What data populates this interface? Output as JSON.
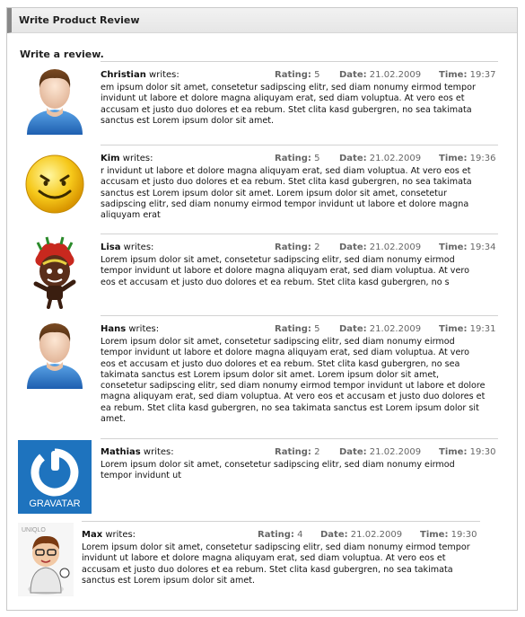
{
  "panel": {
    "title": "Write Product Review"
  },
  "intro": "Write a review.",
  "labels": {
    "writes": "writes:",
    "rating": "Rating:",
    "date": "Date:",
    "time": "Time:"
  },
  "reviews": [
    {
      "author": "Christian",
      "rating": "5",
      "date": "21.02.2009",
      "time": "19:37",
      "avatar_icon": "default-user-avatar-icon",
      "text": "em ipsum dolor sit amet, consetetur sadipscing elitr, sed diam nonumy eirmod tempor invidunt ut labore et dolore magna aliquyam erat, sed diam voluptua. At vero eos et accusam et justo duo dolores et ea rebum. Stet clita kasd gubergren, no sea takimata sanctus est Lorem ipsum dolor sit amet."
    },
    {
      "author": "Kim",
      "rating": "5",
      "date": "21.02.2009",
      "time": "19:36",
      "avatar_icon": "smiley-avatar-icon",
      "text": "r invidunt ut labore et dolore magna aliquyam erat, sed diam voluptua. At vero eos et accusam et justo duo dolores et ea rebum. Stet clita kasd gubergren, no sea takimata sanctus est Lorem ipsum dolor sit amet. Lorem ipsum dolor sit amet, consetetur sadipscing elitr, sed diam nonumy eirmod tempor invidunt ut labore et dolore magna aliquyam erat"
    },
    {
      "author": "Lisa",
      "rating": "2",
      "date": "21.02.2009",
      "time": "19:34",
      "avatar_icon": "monster-avatar-icon",
      "text": "Lorem ipsum dolor sit amet, consetetur sadipscing elitr, sed diam nonumy eirmod tempor invidunt ut labore et dolore magna aliquyam erat, sed diam voluptua. At vero eos et accusam et justo duo dolores et ea rebum. Stet clita kasd gubergren, no s"
    },
    {
      "author": "Hans",
      "rating": "5",
      "date": "21.02.2009",
      "time": "19:31",
      "avatar_icon": "default-user-avatar-icon",
      "text": "Lorem ipsum dolor sit amet, consetetur sadipscing elitr, sed diam nonumy eirmod tempor invidunt ut labore et dolore magna aliquyam erat, sed diam voluptua. At vero eos et accusam et justo duo dolores et ea rebum. Stet clita kasd gubergren, no sea takimata sanctus est Lorem ipsum dolor sit amet. Lorem ipsum dolor sit amet, consetetur sadipscing elitr, sed diam nonumy eirmod tempor invidunt ut labore et dolore magna aliquyam erat, sed diam voluptua. At vero eos et accusam et justo duo dolores et ea rebum. Stet clita kasd gubergren, no sea takimata sanctus est Lorem ipsum dolor sit amet."
    },
    {
      "author": "Mathias",
      "rating": "2",
      "date": "21.02.2009",
      "time": "19:30",
      "avatar_icon": "gravatar-logo-icon",
      "avatar_logo_text": "GRAVATAR",
      "text": "Lorem ipsum dolor sit amet, consetetur sadipscing elitr, sed diam nonumy eirmod tempor invidunt ut"
    },
    {
      "author": "Max",
      "rating": "4",
      "date": "21.02.2009",
      "time": "19:30",
      "avatar_icon": "cartoon-boy-avatar-icon",
      "avatar_logo_text": "UNIQLO",
      "text": "Lorem ipsum dolor sit amet, consetetur sadipscing elitr, sed diam nonumy eirmod tempor invidunt ut labore et dolore magna aliquyam erat, sed diam voluptua. At vero eos et accusam et justo duo dolores et ea rebum. Stet clita kasd gubergren, no sea takimata sanctus est Lorem ipsum dolor sit amet."
    }
  ]
}
